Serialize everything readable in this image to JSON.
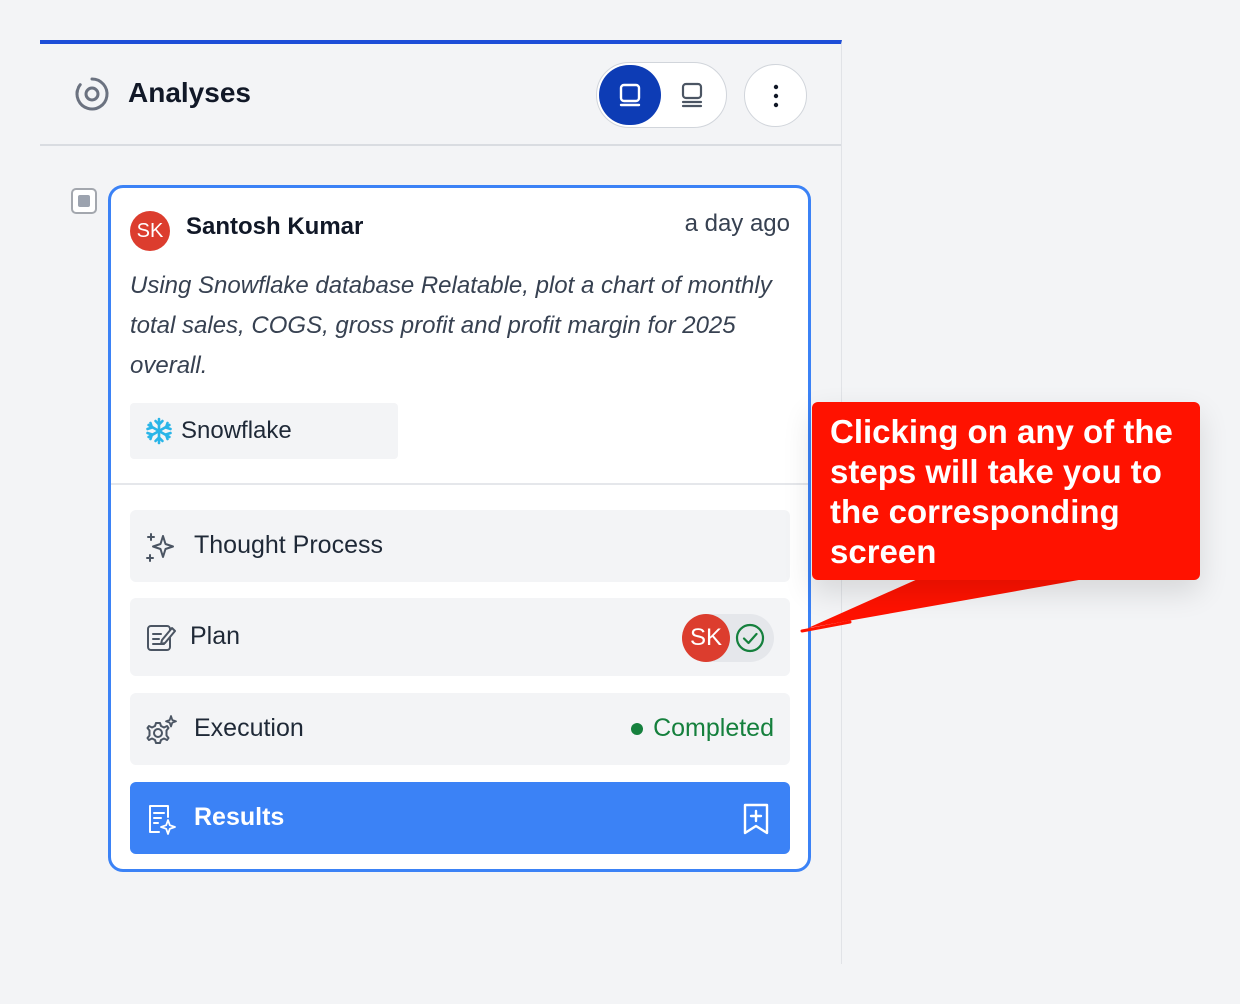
{
  "header": {
    "title": "Analyses",
    "icon": "analyses-icon",
    "view_toggle": {
      "options": [
        "single-card-view-icon",
        "list-view-icon"
      ],
      "selected": 0
    },
    "more_icon": "more-vertical-icon"
  },
  "card": {
    "avatar_initials": "SK",
    "user_name": "Santosh Kumar",
    "time_ago": "a day ago",
    "prompt": "Using Snowflake database Relatable, plot a chart of monthly total sales, COGS, gross profit and profit margin for 2025 overall.",
    "source": {
      "label": "Snowflake",
      "icon": "snowflake-icon"
    },
    "steps": [
      {
        "label": "Thought Process",
        "icon": "sparkles-icon"
      },
      {
        "label": "Plan",
        "icon": "edit-document-icon",
        "approver_initials": "SK",
        "approved": true
      },
      {
        "label": "Execution",
        "icon": "gear-sparkle-icon",
        "status": "Completed"
      },
      {
        "label": "Results",
        "icon": "document-sparkle-icon",
        "action_icon": "bookmark-add-icon"
      }
    ]
  },
  "callout": {
    "text": "Clicking on any of the steps will take you to the corresponding screen"
  },
  "colors": {
    "accent_blue": "#3b82f6",
    "toggle_active": "#0d3cb5",
    "header_top_border": "#1d4ed8",
    "avatar_red": "#dc3d2e",
    "status_green": "#15803d",
    "callout_red": "#ff1200"
  }
}
